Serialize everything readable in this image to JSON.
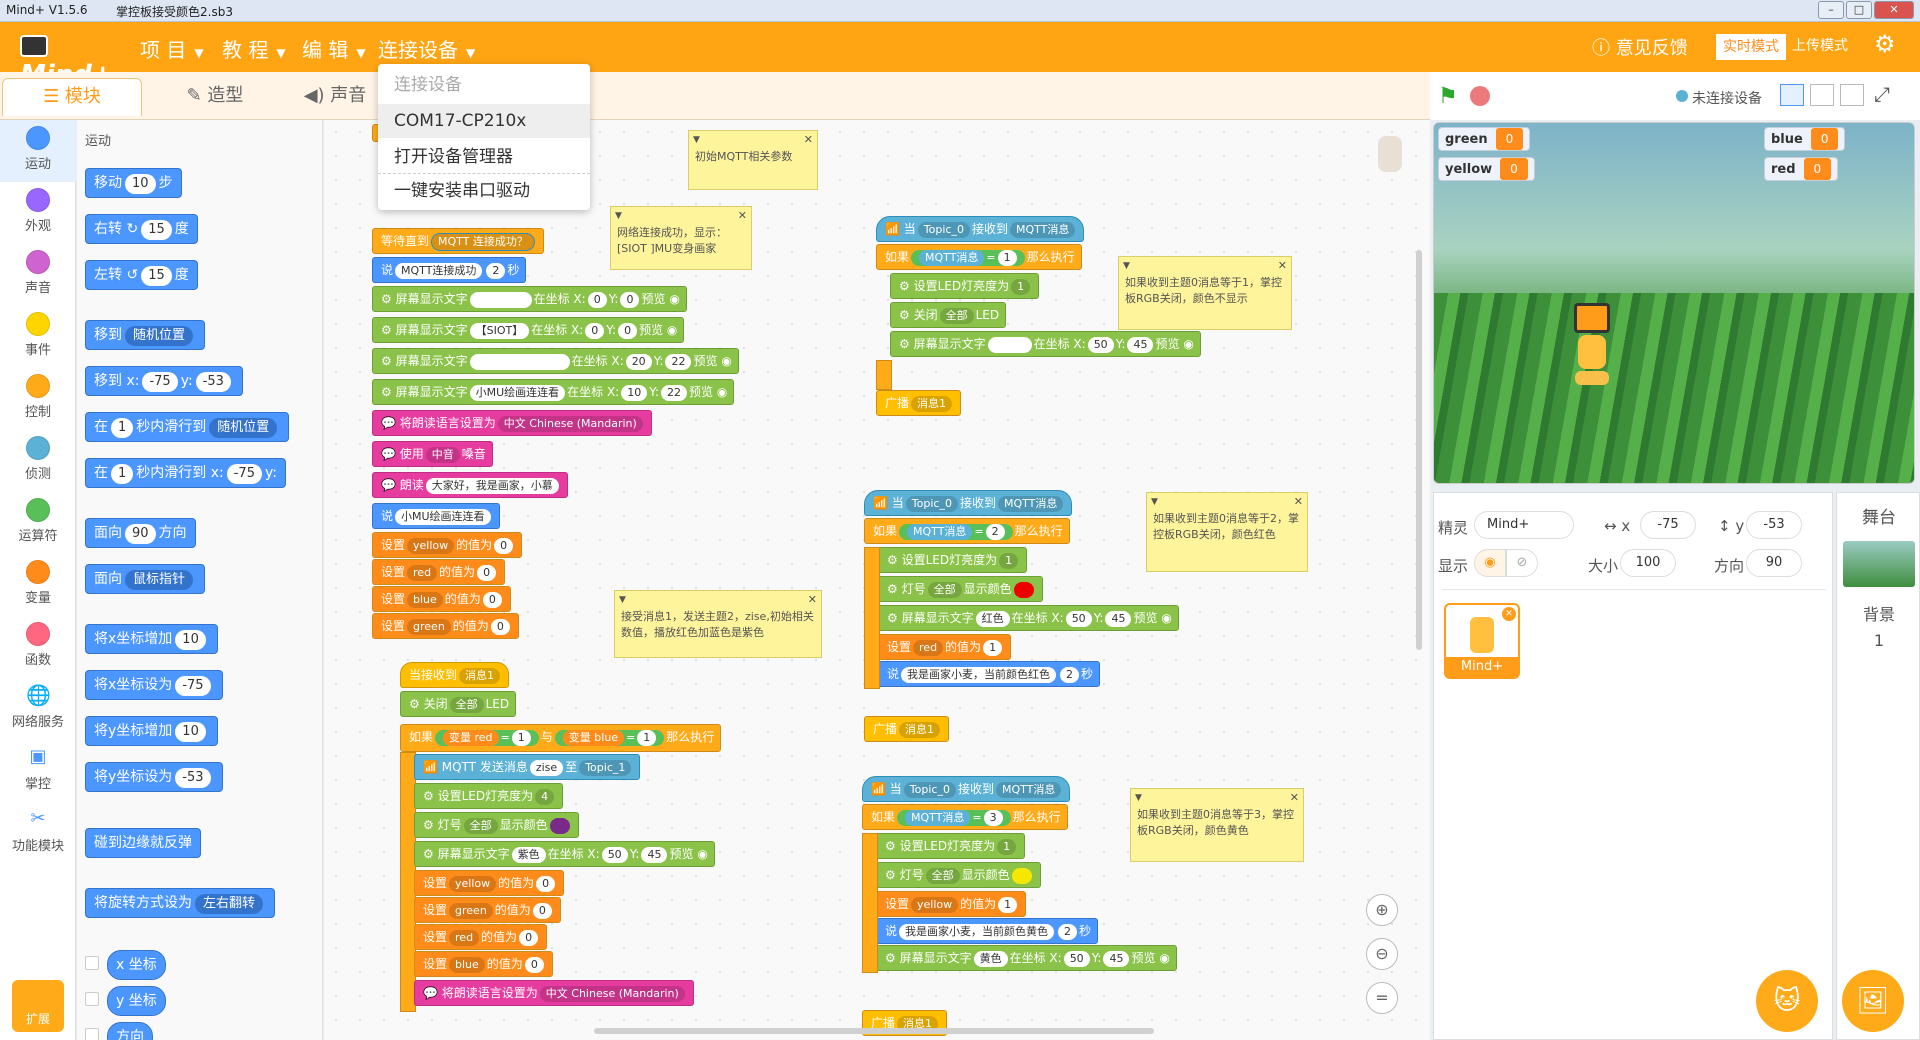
{
  "window": {
    "title": "Mind+ V1.5.6",
    "file": "掌控板接受颜色2.sb3"
  },
  "menubar": {
    "logo": "Mind+",
    "items": [
      "项 目",
      "教 程",
      "编 辑",
      "连接设备"
    ],
    "feedback": "意见反馈",
    "mode_live": "实时模式",
    "mode_upload": "上传模式"
  },
  "tabs": {
    "blocks": "模块",
    "costumes": "造型",
    "sounds": "声音"
  },
  "dropdown": {
    "title": "连接设备",
    "items": [
      "COM17-CP210x",
      "打开设备管理器",
      "一键安装串口驱动"
    ]
  },
  "categories": [
    {
      "label": "运动",
      "color": "#4c97ff"
    },
    {
      "label": "外观",
      "color": "#9966ff"
    },
    {
      "label": "声音",
      "color": "#cf63cf"
    },
    {
      "label": "事件",
      "color": "#ffd500"
    },
    {
      "label": "控制",
      "color": "#ffab19"
    },
    {
      "label": "侦测",
      "color": "#5cb1d6"
    },
    {
      "label": "运算符",
      "color": "#59c059"
    },
    {
      "label": "变量",
      "color": "#ff8c1a"
    },
    {
      "label": "函数",
      "color": "#ff6680"
    },
    {
      "label": "网络服务",
      "color": "#4c97ff"
    },
    {
      "label": "掌控",
      "color": "#4c97ff"
    },
    {
      "label": "功能模块",
      "color": "#4c97ff"
    },
    {
      "label": "扩展",
      "color": "#ffab19"
    }
  ],
  "palette": {
    "header": "运动",
    "move": "移动",
    "steps": "10",
    "step_unit": "步",
    "turn_right": "右转",
    "turn_left": "左转",
    "deg15": "15",
    "deg": "度",
    "goto": "移到",
    "random": "随机位置",
    "goto_xy": "移到 x:",
    "x": "-75",
    "y_label": "y:",
    "y": "-53",
    "glide": "在",
    "one": "1",
    "glide_sec": "秒内滑行到",
    "glide_xy": "秒内滑行到 x:",
    "face": "面向",
    "dir90": "90",
    "dir": "方向",
    "mouse": "鼠标指针",
    "chgx": "将x坐标增加",
    "setx": "将x坐标设为",
    "chgy": "将y坐标增加",
    "sety": "将y坐标设为",
    "ten": "10",
    "bounce": "碰到边缘就反弹",
    "rot": "将旋转方式设为",
    "lr": "左右翻转",
    "xpos": "x 坐标",
    "ypos": "y 坐标",
    "direction": "方向"
  },
  "workspace": {
    "wait_until": "等待直到",
    "mqtt_ok": "MQTT 连接成功？",
    "say": "说",
    "mqtt_ok_say": "MQTT连接成功",
    "two": "2",
    "sec": "秒",
    "screen_text": "屏幕显示文字",
    "at_x": "在坐标 X:",
    "y": "Y:",
    "zero": "0",
    "preview": "预览",
    "siot": "【SIOT】",
    "twenty": "20",
    "twentytwo": "22",
    "ten": "10",
    "art_title": "小MU绘画连连看",
    "tts_lang": "将朗读语言设置为",
    "chinese": "中文 Chinese (Mandarin)",
    "use": "使用",
    "mid": "中音",
    "voice": "嗓音",
    "read": "朗读",
    "greet": "大家好，我是画家，小慕",
    "set": "设置",
    "to_value": "的值为",
    "yellow": "yellow",
    "red": "red",
    "blue": "blue",
    "green": "green",
    "when_recv": "当接收到",
    "msg1": "消息1",
    "off": "关闭",
    "all": "全部",
    "led": "LED",
    "if": "如果",
    "then": "那么执行",
    "var_red": "变量 red",
    "var_blue": "变量 blue",
    "and": "与",
    "eq": "=",
    "one": "1",
    "three": "3",
    "mqtt_send": "MQTT 发送消息",
    "zise": "zise",
    "to": "至",
    "topic1": "Topic_1",
    "topic0": "Topic_0",
    "set_bright": "设置LED灯亮度为",
    "four": "4",
    "lamp": "灯号",
    "show_color": "显示颜色",
    "purple": "紫色",
    "red_cn": "红色",
    "yellow_cn": "黄色",
    "when": "当",
    "recv": "接收到",
    "mqtt_msg": "MQTT消息",
    "broadcast": "广播",
    "say_red": "我是画家小麦，当前颜色红色",
    "say_yellow": "我是画家小麦，当前颜色黄色",
    "fortyfive": "45",
    "fifty": "50"
  },
  "notes": {
    "n1": "初始MQTT相关参数",
    "n2": "网络连接成功，显示：[SIOT ]MU变身画家",
    "n3": "接受消息1，发送主题2，zise,初始相关数值，播放红色加蓝色是紫色",
    "n4": "如果收到主题0消息等于1，掌控板RGB关闭，颜色不显示",
    "n5": "如果收到主题0消息等于2，掌控板RGB关闭，颜色红色",
    "n6": "如果收到主题0消息等于3，掌控板RGB关闭，颜色黄色"
  },
  "stage": {
    "status": "未连接设备",
    "monitors": [
      {
        "name": "green",
        "value": "0"
      },
      {
        "name": "yellow",
        "value": "0"
      },
      {
        "name": "blue",
        "value": "0"
      },
      {
        "name": "red",
        "value": "0"
      }
    ]
  },
  "sprite": {
    "label": "精灵",
    "name": "Mind+",
    "x": "-75",
    "y": "-53",
    "show": "显示",
    "size_label": "大小",
    "size": "100",
    "dir_label": "方向",
    "dir": "90",
    "thumb": "Mind+"
  },
  "stagepanel": {
    "title": "舞台",
    "backdrop": "背景",
    "count": "1"
  }
}
